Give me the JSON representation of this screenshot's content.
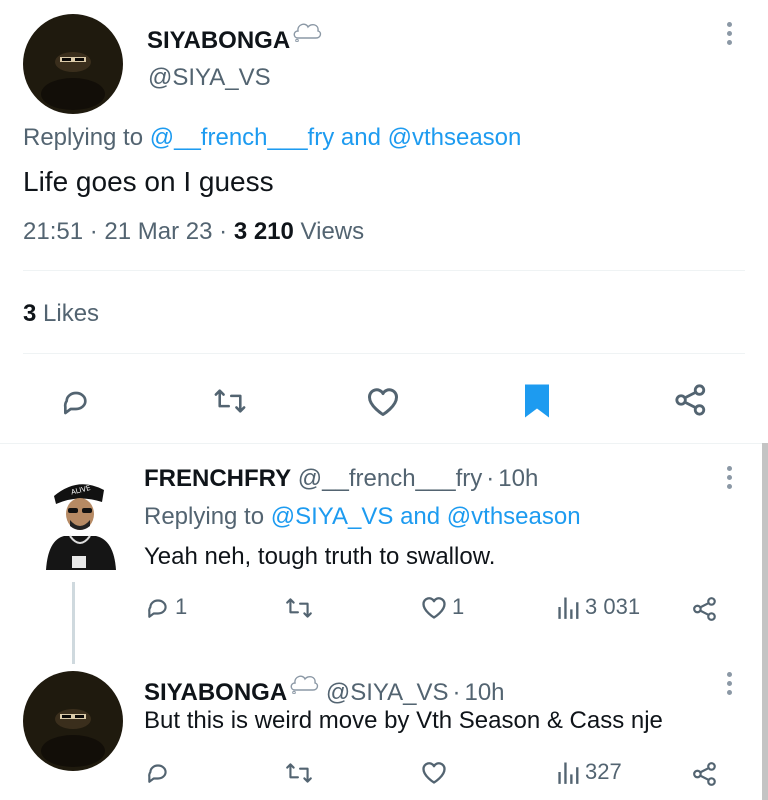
{
  "main_tweet": {
    "display_name": "SIYABONGA",
    "handle": "@SIYA_VS",
    "replying_prefix": "Replying to",
    "replying_user1": "@__french___fry",
    "replying_and": "and",
    "replying_user2": "@vthseason",
    "text": "Life goes on I guess",
    "time": "21:51",
    "sep1": "·",
    "date": "21 Mar 23",
    "sep2": "·",
    "views_count": "3 210",
    "views_label": "Views",
    "likes_count": "3",
    "likes_label": "Likes",
    "bookmarked": true
  },
  "replies": [
    {
      "display_name": "FRENCHFRY",
      "handle": "@__french___fry",
      "sep": "·",
      "time": "10h",
      "replying_prefix": "Replying to",
      "replying_user1": "@SIYA_VS",
      "replying_and": "and",
      "replying_user2": "@vthseason",
      "text": "Yeah neh, tough truth to swallow.",
      "reply_count": "1",
      "like_count": "1",
      "view_count": "3 031"
    },
    {
      "display_name": "SIYABONGA",
      "handle": "@SIYA_VS",
      "sep": "·",
      "time": "10h",
      "text": "But this is weird move by Vth Season & Cass nje",
      "view_count": "327"
    }
  ],
  "colors": {
    "accent": "#1d9bf0",
    "text": "#0f1419",
    "muted": "#536471",
    "divider": "#eff3f4",
    "thread_line": "#cfd9de"
  },
  "icons": [
    "reply-icon",
    "retweet-icon",
    "like-icon",
    "bookmark-icon",
    "share-icon",
    "views-icon",
    "more-icon",
    "thought-bubble-icon"
  ]
}
